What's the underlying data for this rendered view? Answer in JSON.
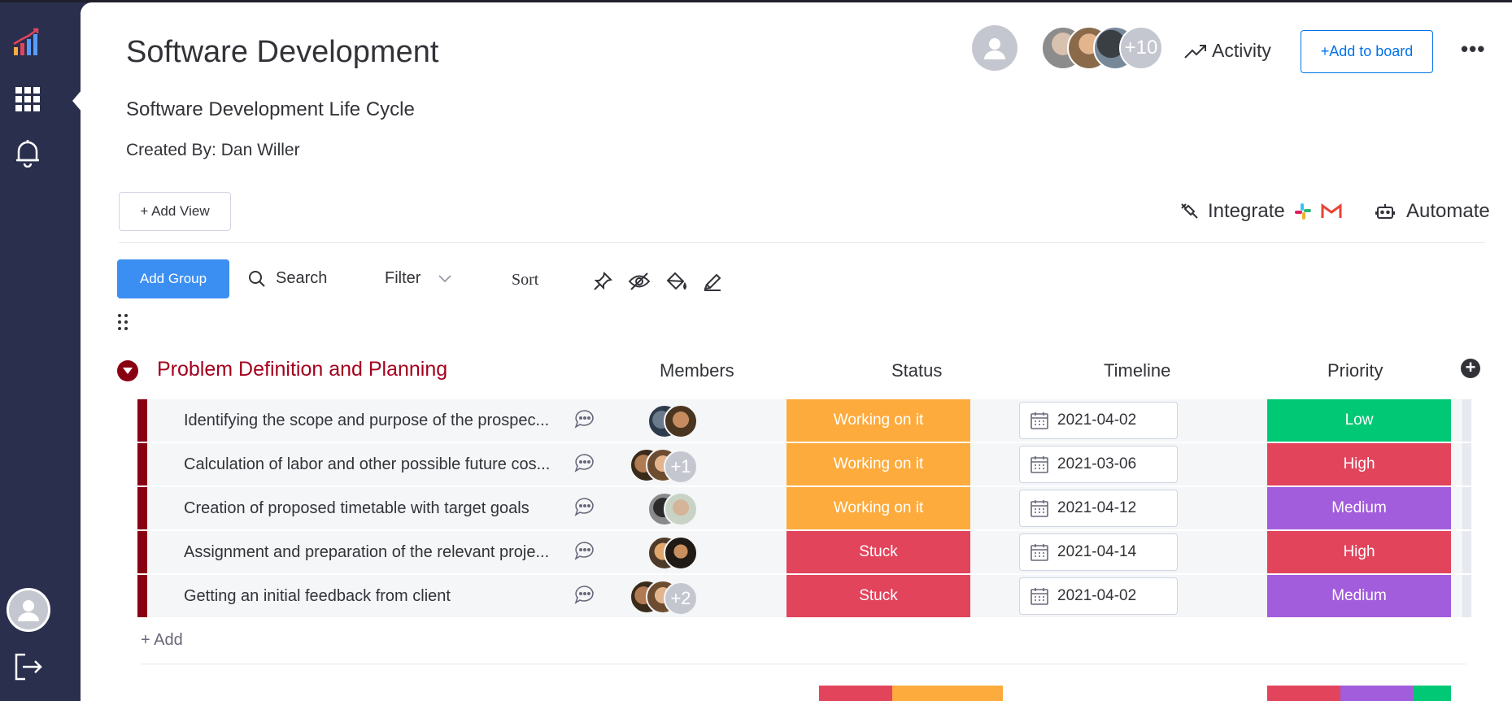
{
  "header": {
    "title": "Software Development",
    "subtitle": "Software Development Life Cycle",
    "created_by": "Created By: Dan Willer",
    "members_more": "+10",
    "activity_label": "Activity",
    "add_to_board_label": "+Add to board",
    "more_menu": "•••"
  },
  "views": {
    "add_view_label": "+ Add View",
    "integrate_label": "Integrate",
    "automate_label": "Automate"
  },
  "toolbar": {
    "add_group_label": "Add Group",
    "search_label": "Search",
    "filter_label": "Filter",
    "sort_label": "Sort"
  },
  "group": {
    "title": "Problem Definition and Planning",
    "color": "#8a0013",
    "columns": {
      "members": "Members",
      "status": "Status",
      "timeline": "Timeline",
      "priority": "Priority"
    },
    "rows": [
      {
        "name": "Identifying the scope and purpose of the prospec...",
        "members_more": "",
        "status": "Working on it",
        "status_color": "#fdab3d",
        "date": "2021-04-02",
        "priority": "Low",
        "priority_color": "#00c875"
      },
      {
        "name": "Calculation of labor and other possible future cos...",
        "members_more": "+1",
        "status": "Working on it",
        "status_color": "#fdab3d",
        "date": "2021-03-06",
        "priority": "High",
        "priority_color": "#e2445c"
      },
      {
        "name": "Creation of proposed timetable with target goals",
        "members_more": "",
        "status": "Working on it",
        "status_color": "#fdab3d",
        "date": "2021-04-12",
        "priority": "Medium",
        "priority_color": "#a25ddc"
      },
      {
        "name": "Assignment and preparation of the relevant proje...",
        "members_more": "",
        "status": "Stuck",
        "status_color": "#e2445c",
        "date": "2021-04-14",
        "priority": "High",
        "priority_color": "#e2445c"
      },
      {
        "name": "Getting an initial feedback from client",
        "members_more": "+2",
        "status": "Stuck",
        "status_color": "#e2445c",
        "date": "2021-04-02",
        "priority": "Medium",
        "priority_color": "#a25ddc"
      }
    ],
    "add_item_label": "+ Add"
  },
  "colors": {
    "sidebar": "#292f4c",
    "primary": "#0073ea",
    "add_group": "#3b8ff2",
    "working": "#fdab3d",
    "stuck": "#e2445c",
    "low": "#00c875",
    "medium": "#a25ddc"
  },
  "icons": [
    "chart-logo-icon",
    "grid-icon",
    "bell-icon",
    "user-avatar-icon",
    "logout-icon",
    "trend-icon",
    "plug-icon",
    "slack-icon",
    "gmail-icon",
    "robot-icon",
    "search-icon",
    "chevron-down-icon",
    "pin-icon",
    "eye-off-icon",
    "paint-bucket-icon",
    "highlighter-icon",
    "drag-dots-icon",
    "chat-icon",
    "calendar-icon",
    "add-column-icon"
  ]
}
